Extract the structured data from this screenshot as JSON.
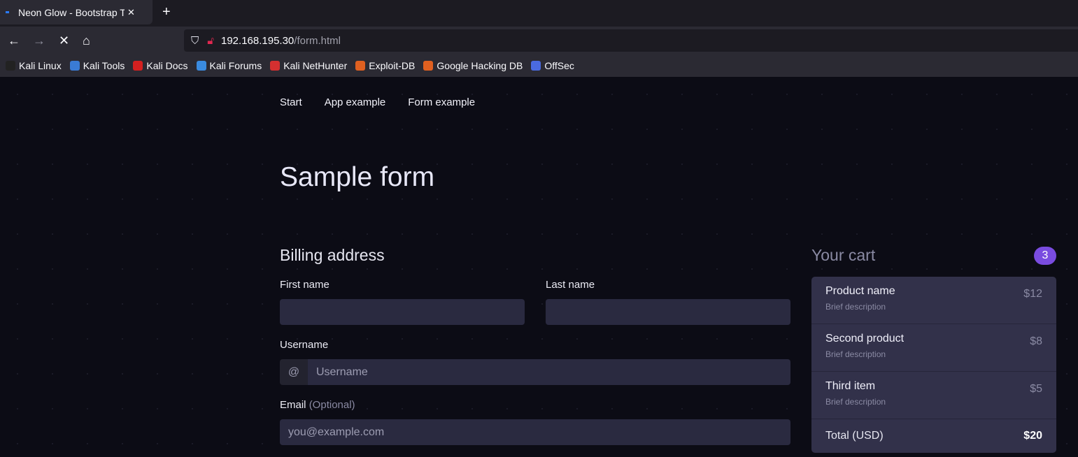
{
  "browser": {
    "tab_title": "Neon Glow - Bootstrap Theme",
    "url_host": "192.168.195.30",
    "url_path": "/form.html",
    "bookmarks": [
      {
        "label": "Kali Linux",
        "color": "#222"
      },
      {
        "label": "Kali Tools",
        "color": "#3a7bd5"
      },
      {
        "label": "Kali Docs",
        "color": "#d42020"
      },
      {
        "label": "Kali Forums",
        "color": "#3a8be0"
      },
      {
        "label": "Kali NetHunter",
        "color": "#d43030"
      },
      {
        "label": "Exploit-DB",
        "color": "#e06020"
      },
      {
        "label": "Google Hacking DB",
        "color": "#e06020"
      },
      {
        "label": "OffSec",
        "color": "#4a6ae0"
      }
    ]
  },
  "nav": {
    "items": [
      "Start",
      "App example",
      "Form example"
    ]
  },
  "page": {
    "title": "Sample form"
  },
  "billing": {
    "title": "Billing address",
    "first_name_label": "First name",
    "last_name_label": "Last name",
    "username_label": "Username",
    "username_addon": "@",
    "username_placeholder": "Username",
    "email_label": "Email",
    "email_optional": "(Optional)",
    "email_placeholder": "you@example.com"
  },
  "cart": {
    "title": "Your cart",
    "count": "3",
    "items": [
      {
        "name": "Product name",
        "desc": "Brief description",
        "price": "$12"
      },
      {
        "name": "Second product",
        "desc": "Brief description",
        "price": "$8"
      },
      {
        "name": "Third item",
        "desc": "Brief description",
        "price": "$5"
      }
    ],
    "total_label": "Total (USD)",
    "total": "$20"
  },
  "colors": {
    "accent": "#7a4ce0",
    "background": "#0c0c15"
  }
}
